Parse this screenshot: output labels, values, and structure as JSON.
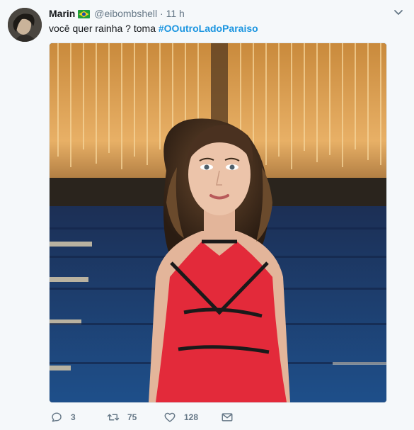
{
  "tweet": {
    "author": {
      "name": "Marin",
      "flag": "brazil-flag-emoji",
      "handle": "@eibombshell",
      "separator": "·",
      "time": "11 h"
    },
    "text": {
      "body": "você quer rainha ? toma ",
      "hashtag": "#OOutroLadoParaiso"
    },
    "media": {
      "icon": "photo-woman-red-dress"
    },
    "actions": {
      "reply": {
        "icon": "reply-icon",
        "count": "3"
      },
      "retweet": {
        "icon": "retweet-icon",
        "count": "75"
      },
      "like": {
        "icon": "heart-icon",
        "count": "128"
      },
      "dm": {
        "icon": "envelope-icon"
      }
    },
    "colors": {
      "background": "#f5f8fa",
      "hashtag": "#1b95e0",
      "muted": "#657786"
    }
  }
}
